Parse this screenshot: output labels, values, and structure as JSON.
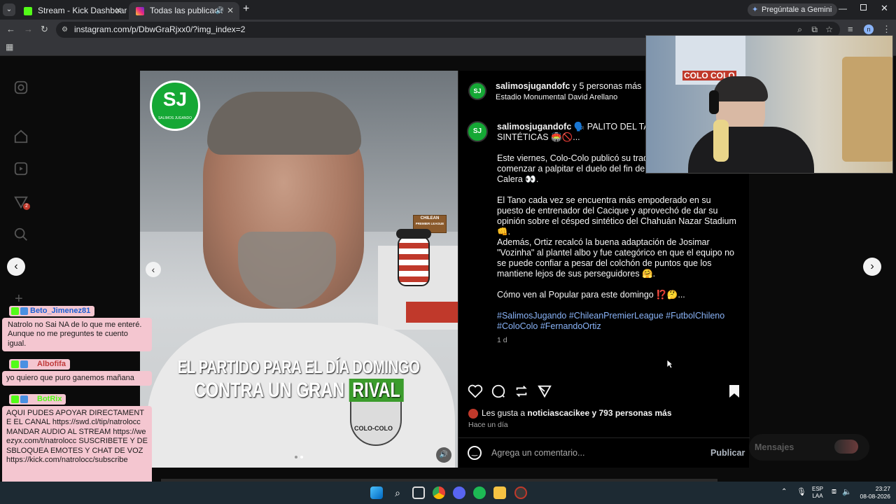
{
  "browser": {
    "tabs": [
      {
        "title": "Stream - Kick Dashboard"
      },
      {
        "title": "Todas las publicaciones • In"
      }
    ],
    "gemini_label": "Pregúntale a Gemini",
    "url": "instagram.com/p/DbwGraRjxx0/?img_index=2"
  },
  "post": {
    "header_user": "salimosjugandofc",
    "header_suffix": " y 5 personas más",
    "location": "Estadio Monumental David Arellano",
    "caption_user": "salimosjugandofc",
    "caption_line1": "🗣️ PALITO DEL TANO PA",
    "caption_line2": "SINTÉTICAS 🏟️🚫...",
    "para1": "Este viernes, Colo-Colo publicó su tradicio",
    "para1b": "comenzar a palpitar el duelo del fin de se",
    "para1c": "Calera 👀.",
    "para2": "El Tano cada vez se encuentra más empoderado en su puesto de entrenador del Cacique y aprovechó de dar su opinión sobre el césped sintético del Chahuán Nazar Stadium 👊.",
    "para3": "Además, Ortiz recalcó la buena adaptación de Josimar \"Vozinha\" al plantel albo y fue categórico en que el equipo no se puede confiar a pesar del colchón de puntos que los mantiene lejos de sus perseguidores 🤗.",
    "para4": "Cómo ven al Popular para este domingo ⁉️🤔...",
    "hashtags1": "#SalimosJugando #ChileanPremierLeague #FutbolChileno",
    "hashtags2": "#ColoColo #FernandoOrtiz",
    "age": "1 d",
    "likes_prefix": "Les gusta a ",
    "likes_user": "noticiascacikee",
    "likes_suffix": " y 793 personas más",
    "time": "Hace un día",
    "comment_placeholder": "Agrega un comentario...",
    "publish": "Publicar",
    "messages": "Mensajes",
    "overlay_line1": "EL PARTIDO PARA EL DÍA DOMINGO",
    "overlay_line2a": "CONTRA UN GRAN ",
    "overlay_line2b": "RIVAL",
    "logo": "SJ",
    "logo_sub": "SALIMOS JUGANDO",
    "sign_line1": "CHILEAN",
    "sign_line2": "PREMIER LEAGUE",
    "crest_text": "COLO-COLO",
    "notif_count": "2"
  },
  "webcam": {
    "poster_text": "COLO COLO"
  },
  "chat": [
    {
      "user": "Beto_Jimenez81",
      "message": "Natrolo no Sai NA de lo que me enteré. Aunque no me preguntes te cuento igual."
    },
    {
      "user": "Albofifa",
      "message": "yo quiero que puro ganemos mañana"
    },
    {
      "user": "BotRix",
      "message": "AQUI PUDES APOYAR DIRECTAMENTE EL CANAL https://swd.cl/tip/natrolocc MANDAR AUDIO AL STREAM https://weezyx.com/t/natrolocc SUSCRIBETE Y DESBLOQUEA EMOTES Y CHAT DE VOZ https://kick.com/natrolocc/subscribe"
    }
  ],
  "taskbar": {
    "lang1": "ESP",
    "lang2": "LAA",
    "time": "23:27",
    "date": "08-08-2026"
  },
  "colors": {
    "kick_green": "#53fc18",
    "ig_link": "#8ab4f8",
    "chat_bg": "#f4c6d0",
    "overlay_green": "#3b9c2c"
  }
}
